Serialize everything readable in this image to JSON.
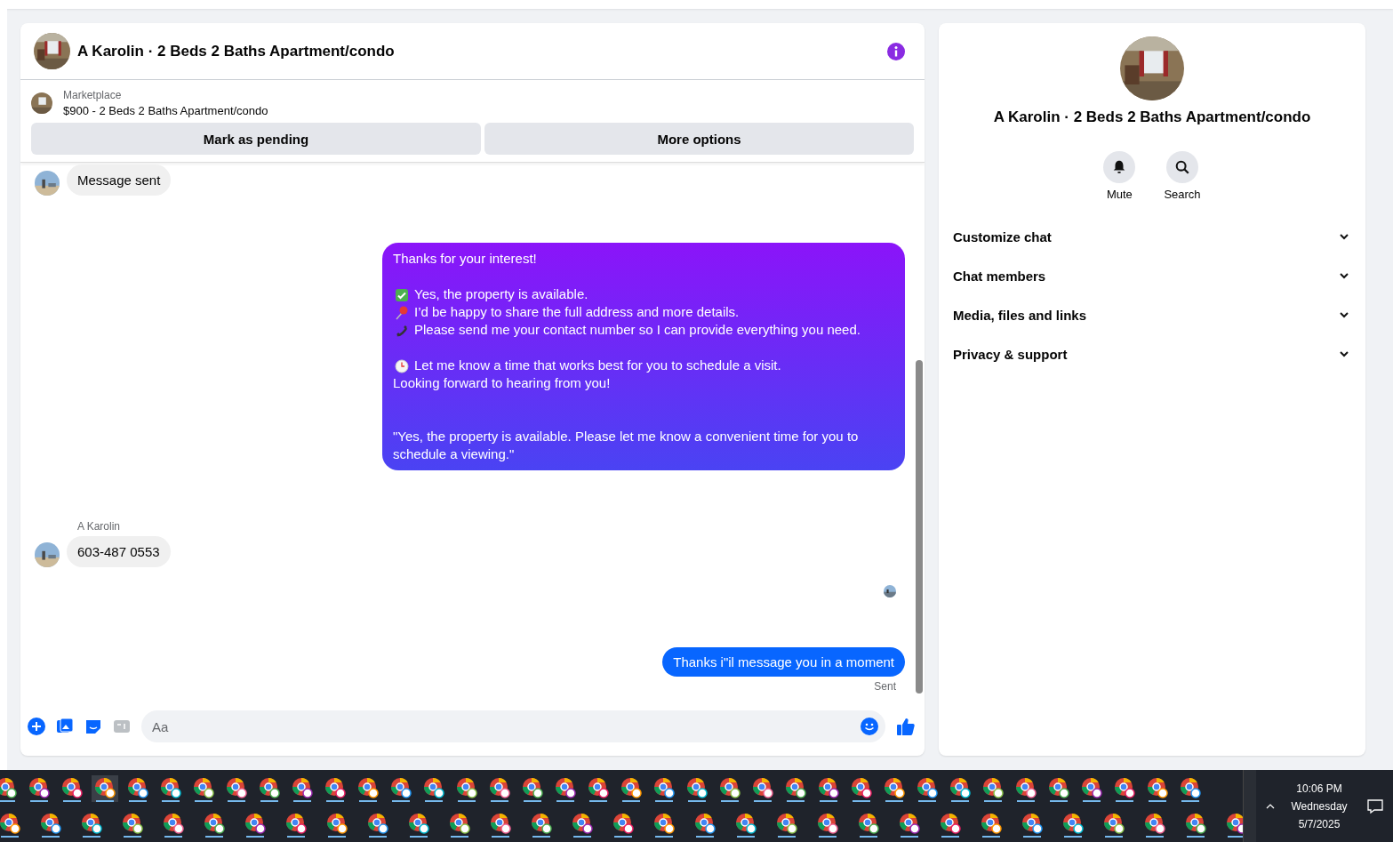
{
  "conversation": {
    "title": "A Karolin · 2 Beds 2 Baths Apartment/condo"
  },
  "listing": {
    "source": "Marketplace",
    "summary": "$900 - 2 Beds 2 Baths Apartment/condo",
    "actions": [
      "Mark as pending",
      "More options"
    ]
  },
  "messages": [
    {
      "kind": "incoming",
      "text": "Message sent"
    },
    {
      "kind": "outgoing_rich",
      "paragraphs": [
        [
          {
            "kind": "plain",
            "text": "Thanks for your interest!"
          }
        ],
        [
          {
            "kind": "check",
            "text": "Yes, the property is available."
          },
          {
            "kind": "pin",
            "text": "I’d be happy to share the full address and more details."
          },
          {
            "kind": "phone",
            "text": "Please send me your contact number so I can provide everything you need."
          }
        ],
        [
          {
            "kind": "clock",
            "text": "Let me know a time that works best for you to schedule a visit."
          },
          {
            "kind": "plain",
            "text": "Looking forward to hearing from you!"
          }
        ],
        [
          {
            "kind": "plain",
            "text": "\"Yes, the property is available. Please let me know a convenient time for you to schedule a viewing.\""
          }
        ]
      ]
    },
    {
      "kind": "incoming",
      "sender": "A Karolin",
      "text": "603-487 0553"
    },
    {
      "kind": "read_receipt"
    },
    {
      "kind": "outgoing",
      "text": "Thanks i\"il message you in a moment",
      "status": "Sent"
    }
  ],
  "composer": {
    "placeholder": "Aa"
  },
  "details": {
    "title": "A Karolin · 2 Beds 2 Baths Apartment/condo",
    "actions": [
      {
        "kind": "mute",
        "label": "Mute"
      },
      {
        "kind": "search",
        "label": "Search"
      }
    ],
    "sections": [
      {
        "label": "Customize chat",
        "expanded": false
      },
      {
        "label": "Chat members",
        "expanded": false
      },
      {
        "label": "Media, files and links",
        "expanded": false
      },
      {
        "label": "Privacy & support",
        "expanded": false
      }
    ]
  },
  "taskbar": {
    "time": "10:06 PM",
    "day": "Wednesday",
    "date": "5/7/2025"
  }
}
